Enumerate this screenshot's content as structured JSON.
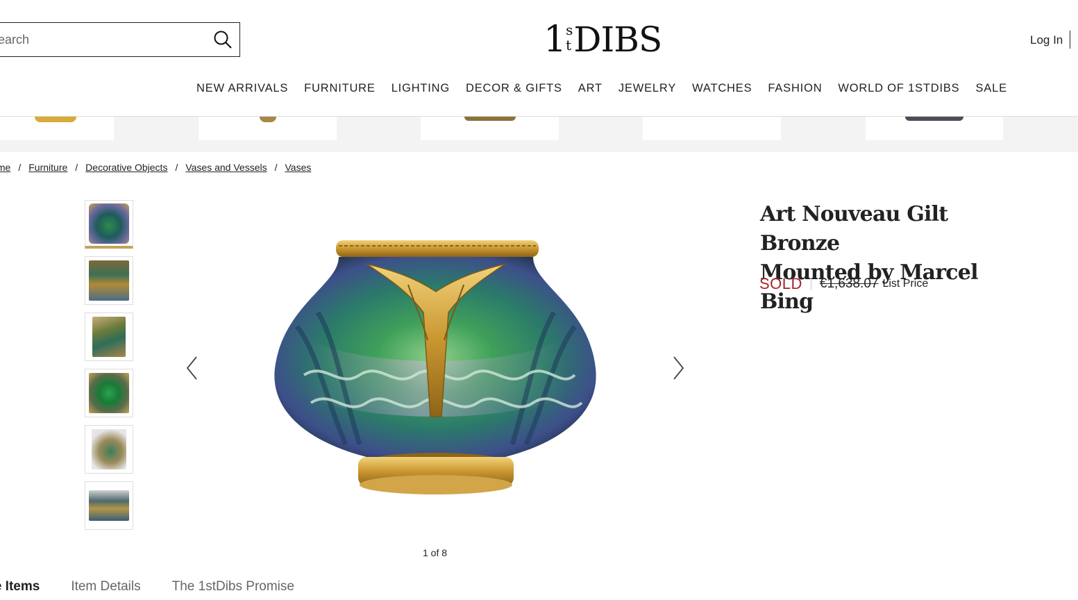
{
  "header": {
    "search": {
      "placeholder": "Search"
    },
    "logo": {
      "one": "1",
      "sup_top": "s",
      "sup_bottom": "t",
      "rest": "DIBS"
    },
    "login_label": "Log In",
    "nav": [
      "NEW ARRIVALS",
      "FURNITURE",
      "LIGHTING",
      "DECOR & GIFTS",
      "ART",
      "JEWELRY",
      "WATCHES",
      "FASHION",
      "WORLD OF 1STDIBS",
      "SALE"
    ]
  },
  "breadcrumb": [
    "Home",
    "Furniture",
    "Decorative Objects",
    "Vases and Vessels",
    "Vases"
  ],
  "gallery": {
    "counter": "1 of 8",
    "thumbnail_count": 6
  },
  "product": {
    "title_line1": "Art Nouveau Gilt Bronze",
    "title_line2": "Mounted by Marcel Bing",
    "status": "SOLD",
    "list_price": "€1,638.07",
    "list_price_label": "List Price"
  },
  "tabs": [
    "More Items",
    "Item Details",
    "The 1stDibs Promise"
  ],
  "colors": {
    "sold": "#a6232a",
    "active_thumb": "#c2a35b"
  }
}
